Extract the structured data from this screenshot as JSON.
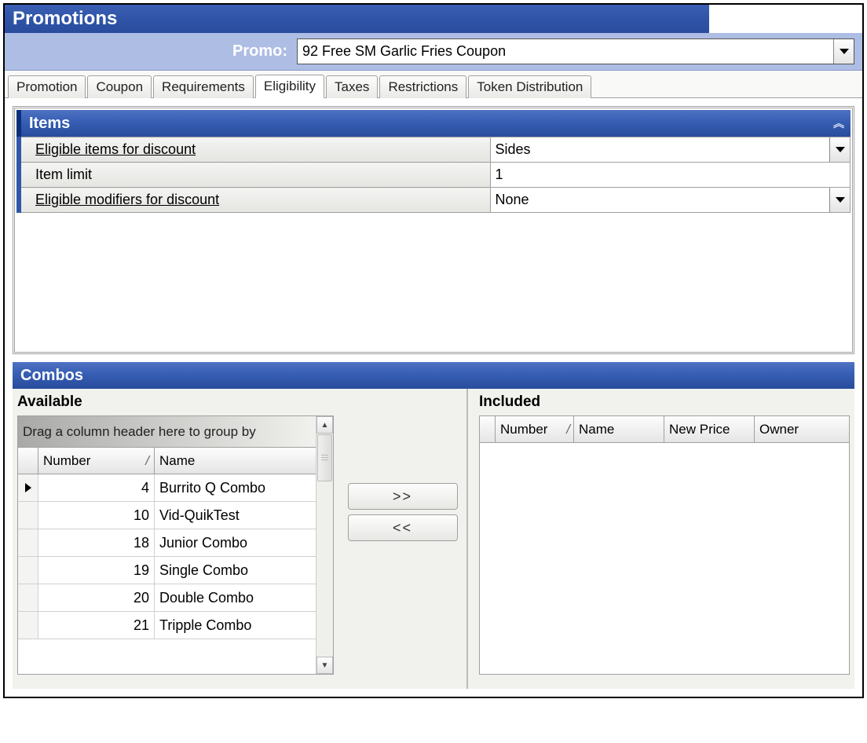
{
  "title": "Promotions",
  "promo": {
    "label": "Promo:",
    "selected": "92 Free SM Garlic Fries Coupon"
  },
  "tabs": [
    {
      "label": "Promotion"
    },
    {
      "label": "Coupon"
    },
    {
      "label": "Requirements"
    },
    {
      "label": "Eligibility",
      "active": true
    },
    {
      "label": "Taxes"
    },
    {
      "label": "Restrictions"
    },
    {
      "label": "Token Distribution"
    }
  ],
  "items_panel": {
    "title": "Items",
    "rows": {
      "eligible_items": {
        "label": "Eligible items for discount",
        "value": "Sides"
      },
      "item_limit": {
        "label": "Item limit",
        "value": "1"
      },
      "eligible_modifiers": {
        "label": "Eligible modifiers for discount",
        "value": "None"
      }
    }
  },
  "combos": {
    "title": "Combos",
    "available": {
      "title": "Available",
      "group_placeholder": "Drag a column header here to group by",
      "columns": {
        "number": "Number",
        "name": "Name"
      },
      "rows": [
        {
          "number": "4",
          "name": "Burrito Q Combo",
          "selected": true
        },
        {
          "number": "10",
          "name": "Vid-QuikTest"
        },
        {
          "number": "18",
          "name": "Junior Combo"
        },
        {
          "number": "19",
          "name": "Single Combo"
        },
        {
          "number": "20",
          "name": "Double Combo"
        },
        {
          "number": "21",
          "name": "Tripple Combo"
        }
      ]
    },
    "buttons": {
      "add": ">>",
      "remove": "<<"
    },
    "included": {
      "title": "Included",
      "columns": {
        "number": "Number",
        "name": "Name",
        "new_price": "New Price",
        "owner": "Owner"
      }
    }
  }
}
